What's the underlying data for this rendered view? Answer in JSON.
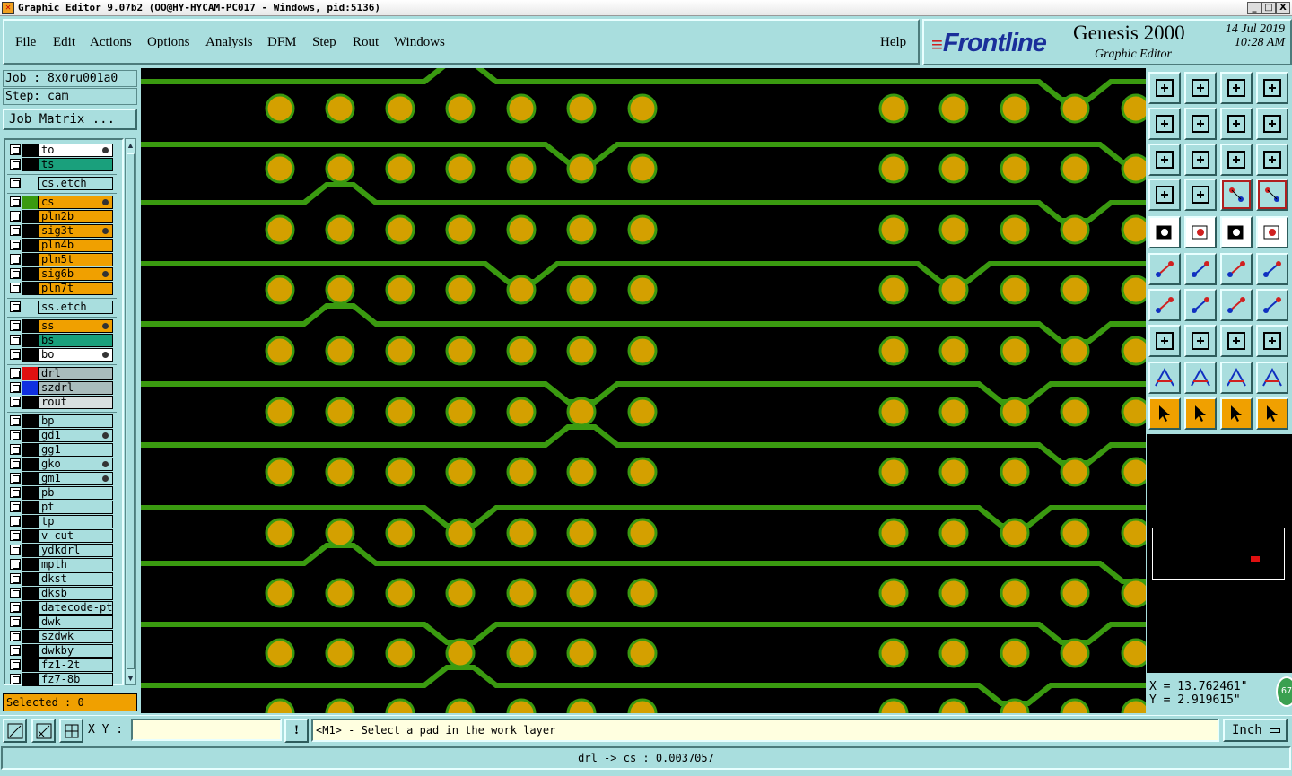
{
  "window": {
    "title": "Graphic Editor 9.07b2 (OO@HY-HYCAM-PC017 - Windows, pid:5136)",
    "controls": [
      "_",
      "□",
      "X"
    ]
  },
  "menu": {
    "items": [
      "File",
      "Edit",
      "Actions",
      "Options",
      "Analysis",
      "DFM",
      "Step",
      "Rout",
      "Windows"
    ],
    "help": "Help"
  },
  "brand": {
    "logo": "Frontline",
    "product": "Genesis 2000",
    "subtitle": "Graphic Editor",
    "date": "14 Jul 2019",
    "time": "10:28 AM"
  },
  "job": {
    "job_label": "Job : 8x0ru001a0",
    "step_label": "Step: cam",
    "matrix_button": "Job Matrix ..."
  },
  "layers": [
    {
      "name": "to",
      "bg": "#ffffff",
      "swatch": "#000000",
      "mark": true
    },
    {
      "name": "ts",
      "bg": "#1aa07c",
      "swatch": "#000000",
      "mark": false
    },
    {
      "name": "cs.etch",
      "bg": "#a9dede",
      "swatch": "#a9dede",
      "mark": false,
      "sep_before": true
    },
    {
      "name": "cs",
      "bg": "#f0a000",
      "swatch": "#3a9a10",
      "mark": true,
      "sep_before": true
    },
    {
      "name": "pln2b",
      "bg": "#f0a000",
      "swatch": "#000000",
      "mark": false
    },
    {
      "name": "sig3t",
      "bg": "#f0a000",
      "swatch": "#000000",
      "mark": true
    },
    {
      "name": "pln4b",
      "bg": "#f0a000",
      "swatch": "#000000",
      "mark": false
    },
    {
      "name": "pln5t",
      "bg": "#f0a000",
      "swatch": "#000000",
      "mark": false
    },
    {
      "name": "sig6b",
      "bg": "#f0a000",
      "swatch": "#000000",
      "mark": true
    },
    {
      "name": "pln7t",
      "bg": "#f0a000",
      "swatch": "#000000",
      "mark": false
    },
    {
      "name": "ss.etch",
      "bg": "#a9dede",
      "swatch": "#a9dede",
      "mark": false,
      "sep_before": true
    },
    {
      "name": "ss",
      "bg": "#f0a000",
      "swatch": "#000000",
      "mark": true,
      "sep_before": true
    },
    {
      "name": "bs",
      "bg": "#1aa07c",
      "swatch": "#000000",
      "mark": false
    },
    {
      "name": "bo",
      "bg": "#ffffff",
      "swatch": "#000000",
      "mark": true
    },
    {
      "name": "drl",
      "bg": "#a9bcbc",
      "swatch": "#e01010",
      "mark": false,
      "sep_before": true
    },
    {
      "name": "szdrl",
      "bg": "#a9bcbc",
      "swatch": "#1030e0",
      "mark": false
    },
    {
      "name": "rout",
      "bg": "#d8e0e0",
      "swatch": "#000000",
      "mark": false
    },
    {
      "name": "bp",
      "bg": "#a9dede",
      "swatch": "#000000",
      "mark": false,
      "sep_before": true
    },
    {
      "name": "gd1",
      "bg": "#a9dede",
      "swatch": "#000000",
      "mark": true
    },
    {
      "name": "gg1",
      "bg": "#a9dede",
      "swatch": "#000000",
      "mark": false
    },
    {
      "name": "gko",
      "bg": "#a9dede",
      "swatch": "#000000",
      "mark": true
    },
    {
      "name": "gm1",
      "bg": "#a9dede",
      "swatch": "#000000",
      "mark": true
    },
    {
      "name": "pb",
      "bg": "#a9dede",
      "swatch": "#000000",
      "mark": false
    },
    {
      "name": "pt",
      "bg": "#a9dede",
      "swatch": "#000000",
      "mark": false
    },
    {
      "name": "tp",
      "bg": "#a9dede",
      "swatch": "#000000",
      "mark": false
    },
    {
      "name": "v-cut",
      "bg": "#a9dede",
      "swatch": "#000000",
      "mark": false
    },
    {
      "name": "ydkdrl",
      "bg": "#a9dede",
      "swatch": "#000000",
      "mark": false
    },
    {
      "name": "mpth",
      "bg": "#a9dede",
      "swatch": "#000000",
      "mark": false
    },
    {
      "name": "dkst",
      "bg": "#a9dede",
      "swatch": "#000000",
      "mark": false
    },
    {
      "name": "dksb",
      "bg": "#a9dede",
      "swatch": "#000000",
      "mark": false
    },
    {
      "name": "datecode-pto",
      "bg": "#a9dede",
      "swatch": "#000000",
      "mark": false
    },
    {
      "name": "dwk",
      "bg": "#a9dede",
      "swatch": "#000000",
      "mark": false
    },
    {
      "name": "szdwk",
      "bg": "#a9dede",
      "swatch": "#000000",
      "mark": false
    },
    {
      "name": "dwkby",
      "bg": "#a9dede",
      "swatch": "#000000",
      "mark": false
    },
    {
      "name": "fz1-2t",
      "bg": "#a9dede",
      "swatch": "#000000",
      "mark": false
    },
    {
      "name": "fz7-8b",
      "bg": "#a9dede",
      "swatch": "#000000",
      "mark": false
    }
  ],
  "selected": "Selected : 0",
  "coordinates": {
    "x": "X = 13.762461\"",
    "y": "Y = 2.919615\"",
    "badge": "67"
  },
  "toolbar": {
    "xy_label": "X Y :",
    "xy_value": "",
    "prompt": "<M1> - Select a pad in the work layer",
    "unit": "Inch"
  },
  "status": "drl -> cs : 0.0037057",
  "colors": {
    "panel": "#a9dede",
    "pad": "#d4a000",
    "trace": "#3a9a10",
    "active_layer": "#f0a000"
  }
}
